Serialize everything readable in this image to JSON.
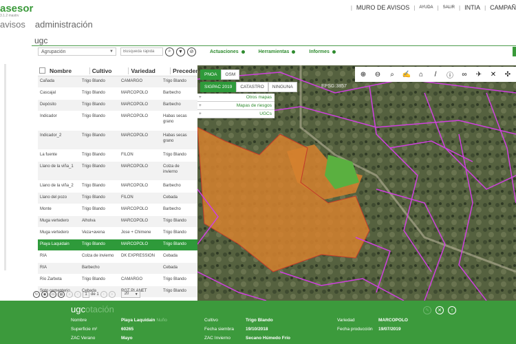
{
  "header": {
    "brand": "asesor",
    "version": "3.1.2 mastrv",
    "nav": {
      "wall": "MURO DE AVISOS",
      "help": "AYUDA",
      "logout": "SALIR",
      "user": "INTIA",
      "campaign": "CAMPAÑ"
    },
    "sections": [
      "avisos",
      "administración"
    ]
  },
  "search": {
    "value": "ugc",
    "group_select": "Agrupación",
    "quick_placeholder": "Búsqueda rápida",
    "menus": [
      "Actuaciones",
      "Herramientas",
      "Informes"
    ]
  },
  "table": {
    "columns": [
      "Nombre",
      "Cultivo",
      "Variedad",
      "Precedente"
    ],
    "rows": [
      {
        "nombre": "Cañada",
        "cultivo": "Trigo Blando",
        "variedad": "CAMARGO",
        "prec": "Trigo Blando"
      },
      {
        "nombre": "Cascajal",
        "cultivo": "Trigo Blando",
        "variedad": "MARCOPOLO",
        "prec": "Barbecho"
      },
      {
        "nombre": "Depósito",
        "cultivo": "Trigo Blando",
        "variedad": "MARCOPOLO",
        "prec": "Barbecho"
      },
      {
        "nombre": "Indicador",
        "cultivo": "Trigo Blando",
        "variedad": "MARCOPOLO",
        "prec": "Habas secas grano"
      },
      {
        "nombre": "Indicador_2",
        "cultivo": "Trigo Blando",
        "variedad": "MARCOPOLO",
        "prec": "Habas secas grano"
      },
      {
        "nombre": "La fuente",
        "cultivo": "Trigo Blando",
        "variedad": "FILON",
        "prec": "Trigo Blando"
      },
      {
        "nombre": "Llano de la viña_1",
        "cultivo": "Trigo Blando",
        "variedad": "MARCOPOLO",
        "prec": "Colza de invierno"
      },
      {
        "nombre": "Llano de la viña_2",
        "cultivo": "Trigo Blando",
        "variedad": "MARCOPOLO",
        "prec": "Barbecho"
      },
      {
        "nombre": "Llano del pozo",
        "cultivo": "Trigo Blando",
        "variedad": "FILON",
        "prec": "Cebada"
      },
      {
        "nombre": "Monte",
        "cultivo": "Trigo Blando",
        "variedad": "MARCOPOLO",
        "prec": "Barbecho"
      },
      {
        "nombre": "Muga vertedero",
        "cultivo": "Alholva",
        "variedad": "MARCOPOLO",
        "prec": "Trigo Blando"
      },
      {
        "nombre": "Muga vertedero",
        "cultivo": "Veza+avena",
        "variedad": "Jose + Chimene",
        "prec": "Trigo Blando"
      },
      {
        "nombre": "Playa Laquidain",
        "cultivo": "Trigo Blando",
        "variedad": "MARCOPOLO",
        "prec": "Trigo Blando",
        "selected": true
      },
      {
        "nombre": "RIA",
        "cultivo": "Colza de invierno",
        "variedad": "DK EXPRESSION",
        "prec": "Cebada"
      },
      {
        "nombre": "RIA",
        "cultivo": "Barbecho",
        "variedad": "",
        "prec": "Cebada"
      },
      {
        "nombre": "Río Zarbeta",
        "cultivo": "Trigo Blando",
        "variedad": "CAMARGO",
        "prec": "Trigo Blando"
      },
      {
        "nombre": "Soto cementerio",
        "cultivo": "Cebada",
        "variedad": "RGT PLANET",
        "prec": "Trigo Blando"
      }
    ]
  },
  "pager": {
    "page": "1",
    "of_label": "de 1",
    "page_size": "20"
  },
  "map": {
    "base_tabs": [
      "PNOA",
      "OSM"
    ],
    "layer_tabs": [
      "SIGPAC 2019",
      "CATASTRO",
      "NINGUNA"
    ],
    "dropdowns": [
      "Otros mapas",
      "Mapas de riesgos",
      "UGCs"
    ],
    "epsg": "EPSG:3857",
    "tools": [
      "zoom-in-icon",
      "zoom-out-icon",
      "zoom-extent-icon",
      "draw-icon",
      "home-icon",
      "ruler-icon",
      "info-icon",
      "binoculars-icon",
      "satellite-icon",
      "satellite-off-icon",
      "drone-icon"
    ]
  },
  "panel": {
    "title_main": "ugc",
    "title_muted": "otación",
    "fields": {
      "nombre_label": "Nombre",
      "nombre_value": "Playa Laquidain",
      "nombre_suffix": "Nuño",
      "superficie_label": "Superficie m²",
      "superficie_value": "60265",
      "zac_verano_label": "ZAC Verano",
      "zac_verano_value": "Mayo",
      "cultivo_label": "Cultivo",
      "cultivo_value": "Trigo Blando",
      "siembra_label": "Fecha siembra",
      "siembra_value": "19/10/2018",
      "zac_invierno_label": "ZAC Invierno",
      "zac_invierno_value": "Secano Húmedo Frío",
      "variedad_label": "Variedad",
      "variedad_value": "MARCOPOLO",
      "produccion_label": "Fecha producción",
      "produccion_value": "19/07/2019"
    }
  },
  "colors": {
    "accent": "#3c9a3c",
    "parcel": "#d6812e",
    "boundary": "#d040e0"
  }
}
